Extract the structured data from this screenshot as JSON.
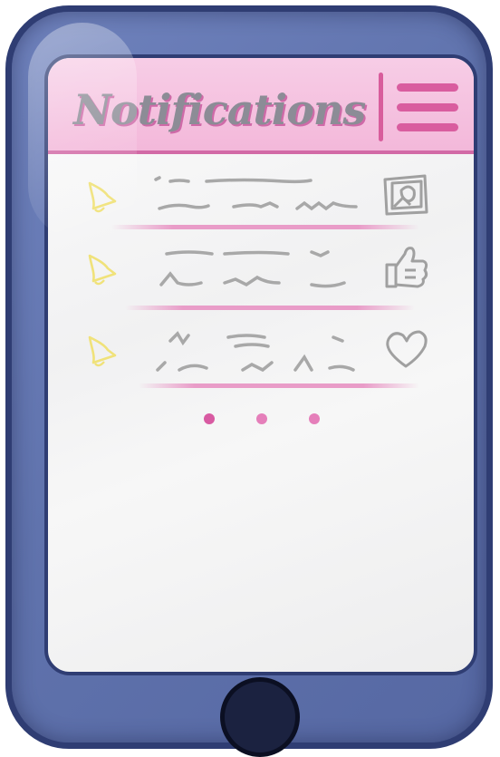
{
  "header": {
    "title": "Notifications",
    "menu_icon": "hamburger-menu-icon"
  },
  "notifications": [
    {
      "icon": "bell-icon",
      "action_icon": "photo-icon"
    },
    {
      "icon": "bell-icon",
      "action_icon": "thumbs-up-icon"
    },
    {
      "icon": "bell-icon",
      "action_icon": "heart-icon"
    }
  ],
  "pagination": {
    "dots": 3
  },
  "colors": {
    "accent_pink": "#d85aa2",
    "header_pink": "#f3b8da",
    "phone_body": "#6073ad",
    "phone_outline": "#2f3d73",
    "screen_bg": "#f4f4f4",
    "bell_yellow": "#f0e27a",
    "placeholder_gray": "#a8a8a8"
  }
}
